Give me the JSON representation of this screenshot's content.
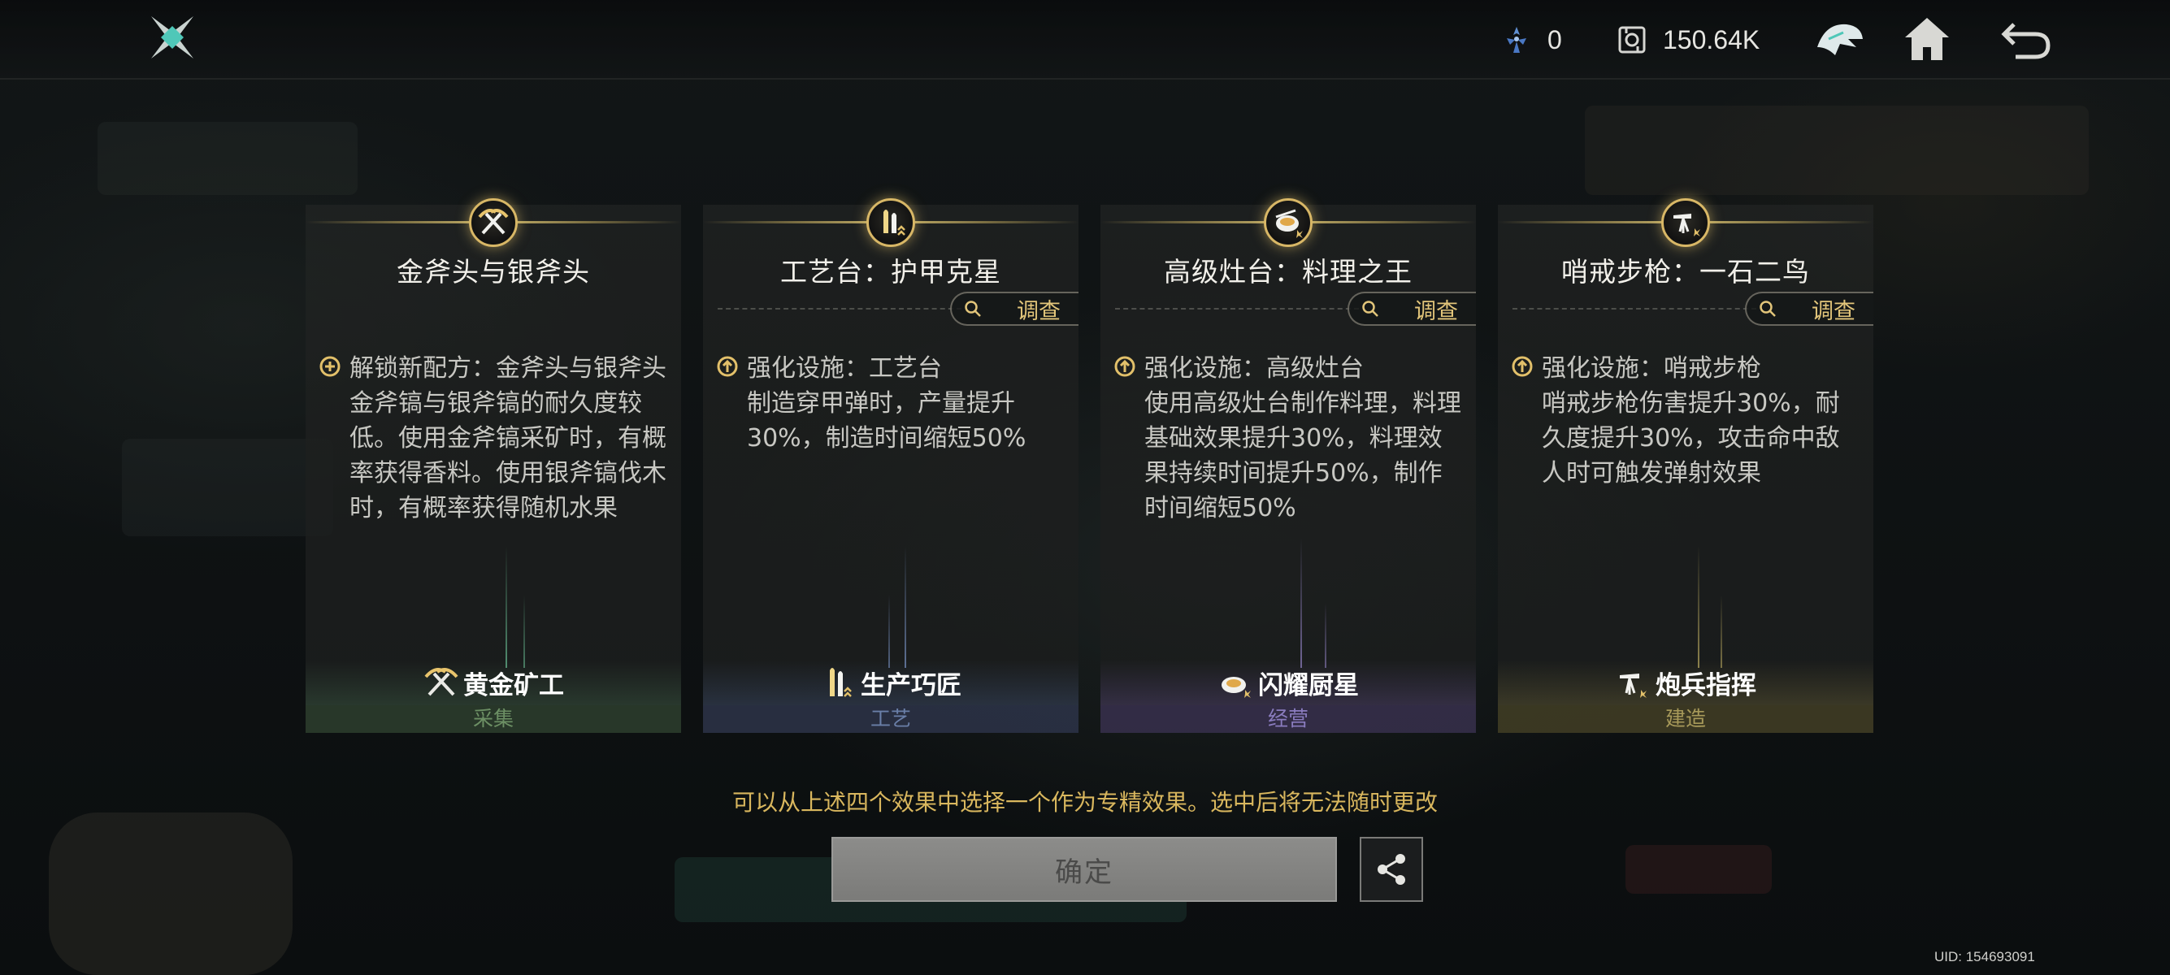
{
  "topbar": {
    "logo_icon": "shuriken-icon",
    "resources": [
      {
        "icon": "crystal-icon",
        "value": "0"
      },
      {
        "icon": "gear-box-icon",
        "value": "150.64K"
      }
    ],
    "buttons": [
      "helmet-icon",
      "home-icon",
      "back-icon"
    ]
  },
  "cards": [
    {
      "badge_icon": "crossed-pickaxes-icon",
      "title": "金斧头与银斧头",
      "has_inspect": false,
      "line_icon": "plus-circle-icon",
      "line": "解锁新配方：金斧头与银斧头",
      "desc": "金斧镐与银斧镐的耐久度较低。使用金斧镐采矿时，有概率获得香料。使用银斧镐伐木时，有概率获得随机水果",
      "footer_label": "黄金矿工",
      "category": "采集",
      "category_color": "#6c8f64"
    },
    {
      "badge_icon": "bullets-icon",
      "title": "工艺台：护甲克星",
      "has_inspect": true,
      "inspect_label": "调查",
      "line_icon": "up-arrow-circle-icon",
      "line": "强化设施：工艺台",
      "desc": "制造穿甲弹时，产量提升30%，制造时间缩短50%",
      "footer_label": "生产巧匠",
      "category": "工艺",
      "category_color": "#6a7fa8"
    },
    {
      "badge_icon": "cooking-pot-icon",
      "title": "高级灶台：料理之王",
      "has_inspect": true,
      "inspect_label": "调查",
      "line_icon": "up-arrow-circle-icon",
      "line": "强化设施：高级灶台",
      "desc": "使用高级灶台制作料理，料理基础效果提升30%，料理效果持续时间提升50%，制作时间缩短50%",
      "footer_label": "闪耀厨星",
      "category": "经营",
      "category_color": "#8a7cbf"
    },
    {
      "badge_icon": "sentry-gun-icon",
      "title": "哨戒步枪：一石二鸟",
      "has_inspect": true,
      "inspect_label": "调查",
      "line_icon": "up-arrow-circle-icon",
      "line": "强化设施：哨戒步枪",
      "desc": "哨戒步枪伤害提升30%，耐久度提升30%，攻击命中敌人时可触发弹射效果",
      "footer_label": "炮兵指挥",
      "category": "建造",
      "category_color": "#a89a5a"
    }
  ],
  "hint": "可以从上述四个效果中选择一个作为专精效果。选中后将无法随时更改",
  "confirm_label": "确定",
  "share_icon": "share-icon",
  "uid": "UID: 154693091",
  "colors": {
    "gold": "#d9b75e",
    "accent": "#e2c57a"
  }
}
